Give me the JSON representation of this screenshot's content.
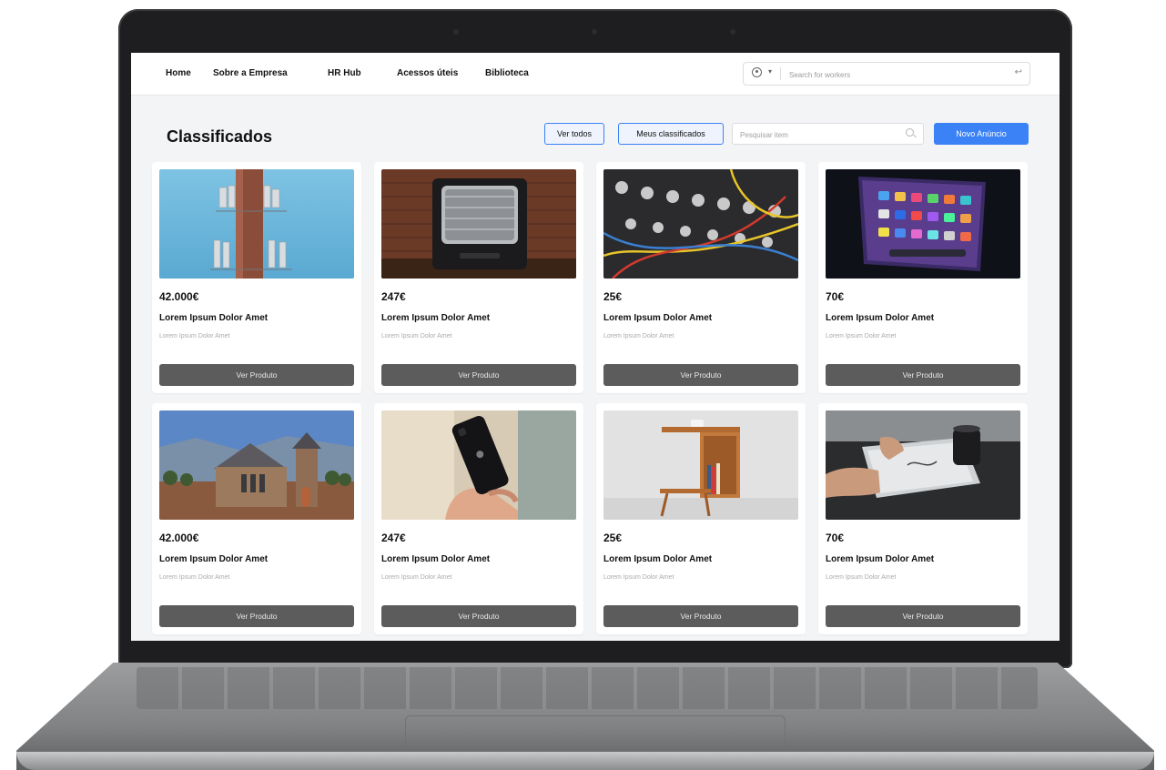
{
  "nav": {
    "items": [
      "Home",
      "Sobre a Empresa",
      "HR Hub",
      "Acessos úteis",
      "Biblioteca"
    ],
    "search_placeholder": "Search for workers",
    "caret": "▾",
    "enter_glyph": "↩"
  },
  "header": {
    "title": "Classificados",
    "view_all": "Ver todos",
    "my_ads": "Meus classificados",
    "item_search_placeholder": "Pesquisar item",
    "new_ad": "Novo Anúncio"
  },
  "colors": {
    "accent": "#3b82f6",
    "card_button": "#5c5c5c",
    "background": "#f3f4f6"
  },
  "cards": [
    {
      "price": "42.000€",
      "title": "Lorem Ipsum Dolor Amet",
      "desc": "Lorem Ipsum Dolor Amet",
      "button": "Ver Produto",
      "image": "cell-tower-image"
    },
    {
      "price": "247€",
      "title": "Lorem Ipsum Dolor Amet",
      "desc": "Lorem Ipsum Dolor Amet",
      "button": "Ver Produto",
      "image": "retro-tv-image"
    },
    {
      "price": "25€",
      "title": "Lorem Ipsum Dolor Amet",
      "desc": "Lorem Ipsum Dolor Amet",
      "button": "Ver Produto",
      "image": "modular-synth-image"
    },
    {
      "price": "70€",
      "title": "Lorem Ipsum Dolor Amet",
      "desc": "Lorem Ipsum Dolor Amet",
      "button": "Ver Produto",
      "image": "monitor-apps-image"
    },
    {
      "price": "42.000€",
      "title": "Lorem Ipsum Dolor Amet",
      "desc": "Lorem Ipsum Dolor Amet",
      "button": "Ver Produto",
      "image": "stone-church-image"
    },
    {
      "price": "247€",
      "title": "Lorem Ipsum Dolor Amet",
      "desc": "Lorem Ipsum Dolor Amet",
      "button": "Ver Produto",
      "image": "smartphone-hand-image"
    },
    {
      "price": "25€",
      "title": "Lorem Ipsum Dolor Amet",
      "desc": "Lorem Ipsum Dolor Amet",
      "button": "Ver Produto",
      "image": "wooden-side-table-image"
    },
    {
      "price": "70€",
      "title": "Lorem Ipsum Dolor Amet",
      "desc": "Lorem Ipsum Dolor Amet",
      "button": "Ver Produto",
      "image": "drawing-tablet-image"
    }
  ]
}
